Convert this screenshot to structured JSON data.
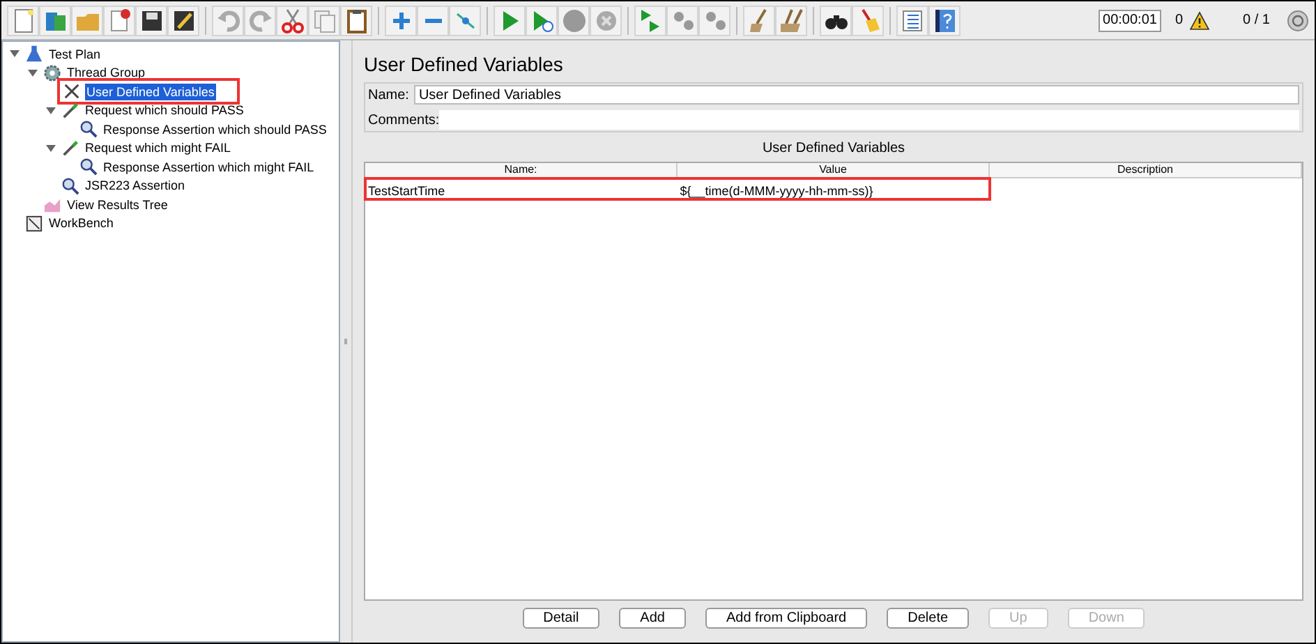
{
  "toolbar": {
    "timer": "00:00:01",
    "warnings": "0",
    "threads": "0 / 1"
  },
  "tree": [
    {
      "label": "Test Plan",
      "kind": "plan",
      "expanded": true,
      "selected": false,
      "highlighted": false,
      "children": [
        {
          "label": "Thread Group",
          "kind": "threads",
          "expanded": true,
          "selected": false,
          "highlighted": false,
          "children": [
            {
              "label": "User Defined Variables",
              "kind": "config",
              "selected": true,
              "highlighted": true
            },
            {
              "label": "Request which should PASS",
              "kind": "sampler",
              "expanded": true,
              "selected": false,
              "highlighted": false,
              "children": [
                {
                  "label": "Response Assertion which should PASS",
                  "kind": "assertion",
                  "selected": false,
                  "highlighted": false
                }
              ]
            },
            {
              "label": "Request which might FAIL",
              "kind": "sampler",
              "expanded": true,
              "selected": false,
              "highlighted": false,
              "children": [
                {
                  "label": "Response Assertion which might FAIL",
                  "kind": "assertion",
                  "selected": false,
                  "highlighted": false
                }
              ]
            },
            {
              "label": "JSR223 Assertion",
              "kind": "assertion",
              "selected": false,
              "highlighted": false
            }
          ]
        },
        {
          "label": "View Results Tree",
          "kind": "listener",
          "selected": false,
          "highlighted": false
        }
      ]
    },
    {
      "label": "WorkBench",
      "kind": "workbench",
      "selected": false,
      "highlighted": false
    }
  ],
  "panel": {
    "title": "User Defined Variables",
    "name_label": "Name:",
    "name_value": "User Defined Variables",
    "comments_label": "Comments:",
    "table_title": "User Defined Variables",
    "columns": [
      "Name:",
      "Value",
      "Description"
    ],
    "rows": [
      {
        "cells": [
          "TestStartTime",
          "${__time(d-MMM-yyyy-hh-mm-ss)}",
          ""
        ],
        "highlighted": true
      }
    ],
    "buttons": [
      {
        "label": "Detail",
        "disabled": false
      },
      {
        "label": "Add",
        "disabled": false
      },
      {
        "label": "Add from Clipboard",
        "disabled": false
      },
      {
        "label": "Delete",
        "disabled": false
      },
      {
        "label": "Up",
        "disabled": true
      },
      {
        "label": "Down",
        "disabled": true
      }
    ]
  }
}
